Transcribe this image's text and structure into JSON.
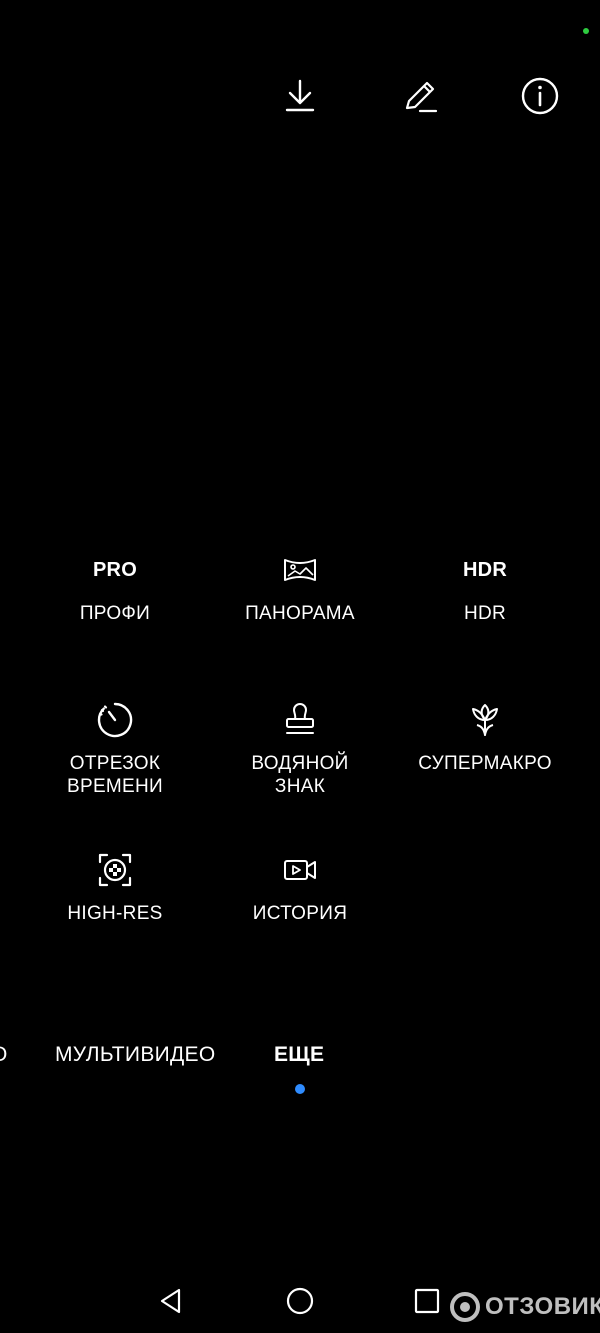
{
  "top_bar": {
    "download_icon": "download-icon",
    "edit_icon": "pencil-icon",
    "info_icon": "info-icon"
  },
  "modes": [
    {
      "icon_text": "PRO",
      "label": "ПРОФИ"
    },
    {
      "icon": "panorama-icon",
      "label": "ПАНОРАМА"
    },
    {
      "icon_text": "HDR",
      "label": "HDR"
    },
    {
      "icon": "timelapse-icon",
      "label": "ОТРЕЗОК\nВРЕМЕНИ"
    },
    {
      "icon": "stamp-icon",
      "label": "ВОДЯНОЙ\nЗНАК"
    },
    {
      "icon": "flower-icon",
      "label": "СУПЕРМАКРО"
    },
    {
      "icon": "high-res-icon",
      "label": "HIGH-RES"
    },
    {
      "icon": "story-video-icon",
      "label": "ИСТОРИЯ"
    }
  ],
  "tabs": {
    "partial": "О",
    "multivideo": "МУЛЬТИВИДЕО",
    "more": "ЕЩЕ"
  },
  "nav": {
    "back_icon": "back-triangle-icon",
    "home_icon": "home-circle-icon",
    "recents_icon": "recents-square-icon"
  },
  "watermark": {
    "text": "ОТЗОВИК"
  },
  "colors": {
    "background": "#000000",
    "accent": "#2f8cff",
    "status_dot": "#2ecc40"
  }
}
